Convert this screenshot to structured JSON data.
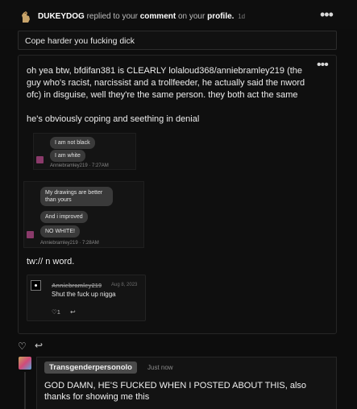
{
  "notification": {
    "actor": "DUKEYDOG",
    "text_before": "replied to your",
    "comment_word": "comment",
    "text_on": "on your",
    "profile_word": "profile.",
    "age": "1d"
  },
  "reply_preview": {
    "text": "Cope harder you fucking dick"
  },
  "post": {
    "paragraph1": "oh yea btw, bfdifan381 is CLEARLY lolaloud368/anniebramley219 (the guy who's racist, narcissist and a trollfeeder, he actually said the nword ofc) in disguise, well they're the same person. they both act the same",
    "paragraph2": "he's obviously coping and seething in denial",
    "screenshot1": {
      "bubble1": "I am not black",
      "bubble2": "I am white",
      "meta": "Anniebramley219 · 7:27AM"
    },
    "screenshot2": {
      "bubble1": "My drawings are better than yours",
      "bubble2": "And i improved",
      "bubble3": "NO WHITE!",
      "meta": "Anniebramley219 · 7:28AM"
    },
    "warning": "tw:// n word.",
    "screenshot3": {
      "name": "Anniebramley219",
      "date": "Aug 8, 2023",
      "message": "Shut the fuck up nigga",
      "reaction_count": "1"
    }
  },
  "comment": {
    "username": "Transgenderpersonolo",
    "time": "Just now",
    "text": "GOD DAMN, HE'S FUCKED WHEN I POSTED ABOUT THIS, also thanks for showing me this"
  },
  "colors": {
    "background": "#0d0d0d",
    "card": "#131313",
    "pill": "#4a4a4a",
    "bubble": "#3a3a3a"
  }
}
